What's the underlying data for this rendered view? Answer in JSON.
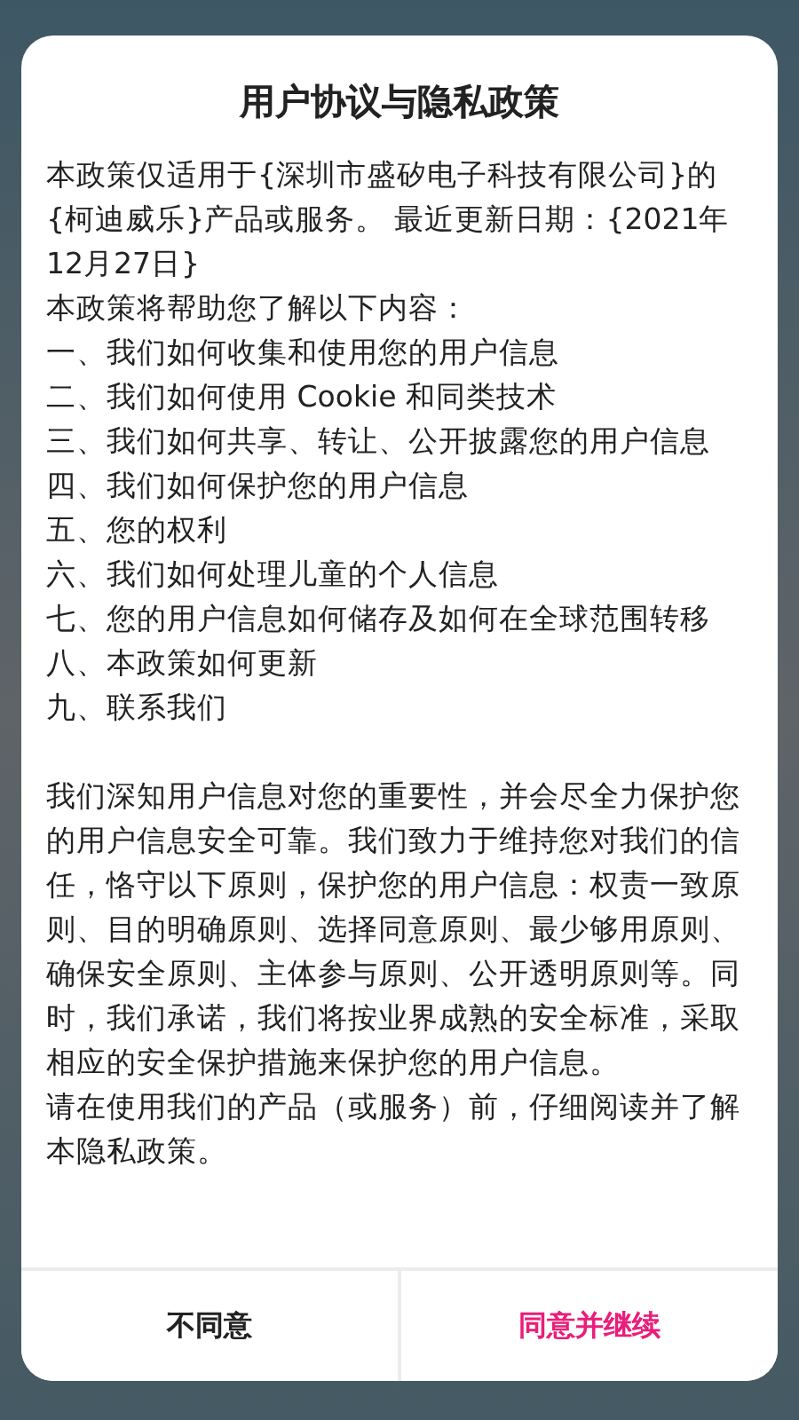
{
  "dialog": {
    "title": "用户协议与隐私政策",
    "intro": "本政策仅适用于{深圳市盛矽电子科技有限公司}的{柯迪威乐}产品或服务。 最近更新日期：{2021年12月27日}",
    "lead": "本政策将帮助您了解以下内容：",
    "items": [
      "一、我们如何收集和使用您的用户信息",
      "二、我们如何使用 Cookie 和同类技术",
      "三、我们如何共享、转让、公开披露您的用户信息",
      "四、我们如何保护您的用户信息",
      "五、您的权利",
      "六、我们如何处理儿童的个人信息",
      "七、您的用户信息如何储存及如何在全球范围转移",
      "八、本政策如何更新",
      "九、联系我们"
    ],
    "paragraphs": [
      "我们深知用户信息对您的重要性，并会尽全力保护您的用户信息安全可靠。我们致力于维持您对我们的信任，恪守以下原则，保护您的用户信息：权责一致原则、目的明确原则、选择同意原则、最少够用原则、确保安全原则、主体参与原则、公开透明原则等。同时，我们承诺，我们将按业界成熟的安全标准，采取相应的安全保护措施来保护您的用户信息。",
      "请在使用我们的产品（或服务）前，仔细阅读并了解本隐私政策。"
    ],
    "buttons": [
      {
        "label": "不同意",
        "kind": "secondary"
      },
      {
        "label": "同意并继续",
        "kind": "primary"
      }
    ]
  }
}
